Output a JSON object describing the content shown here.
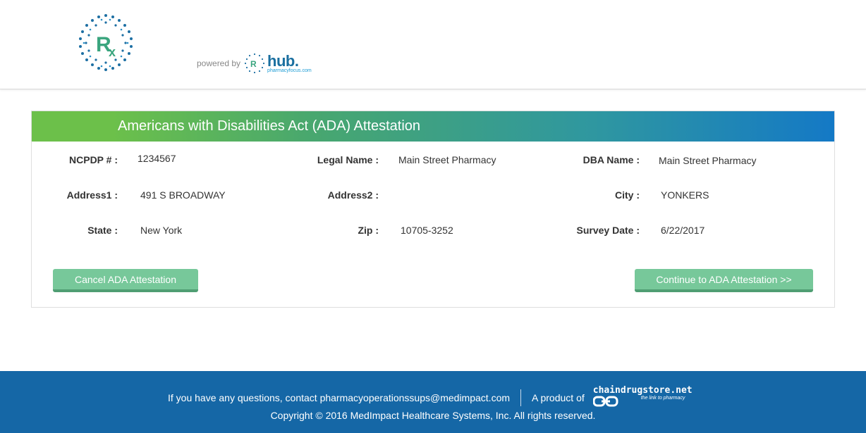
{
  "header": {
    "logo_icon": "rx-globe-logo",
    "powered_by": "powered by",
    "hub_logo_word": "hub.",
    "hub_logo_sub": "pharmacyfocus.com"
  },
  "panel": {
    "title": "Americans with Disabilities Act (ADA) Attestation",
    "fields": {
      "ncpdp": {
        "label": "NCPDP # :",
        "value": "1234567"
      },
      "legal_name": {
        "label": "Legal Name :",
        "value": "Main Street Pharmacy"
      },
      "dba_name": {
        "label": "DBA Name :",
        "value": "Main Street Pharmacy"
      },
      "address1": {
        "label": "Address1 :",
        "value": "491 S BROADWAY"
      },
      "address2": {
        "label": "Address2 :",
        "value": ""
      },
      "city": {
        "label": "City :",
        "value": "YONKERS"
      },
      "state": {
        "label": "State :",
        "value": "New York"
      },
      "zip": {
        "label": "Zip :",
        "value": "10705-3252"
      },
      "survey_date": {
        "label": "Survey Date :",
        "value": "6/22/2017"
      }
    },
    "cancel_label": "Cancel ADA Attestation",
    "continue_label": "Continue to ADA Attestation >>"
  },
  "footer": {
    "contact_text": "If you have any questions, contact pharmacyoperationssups@medimpact.com",
    "product_of": "A product of",
    "chain_name": "chaindrugstore.net",
    "chain_tagline": "the link to pharmacy",
    "copyright": "Copyright © 2016 MedImpact Healthcare Systems, Inc. All rights reserved."
  },
  "colors": {
    "header_gradient_start": "#6cc04a",
    "header_gradient_end": "#1479c6",
    "button_green": "#77c89a",
    "footer_blue": "#1567a6"
  }
}
